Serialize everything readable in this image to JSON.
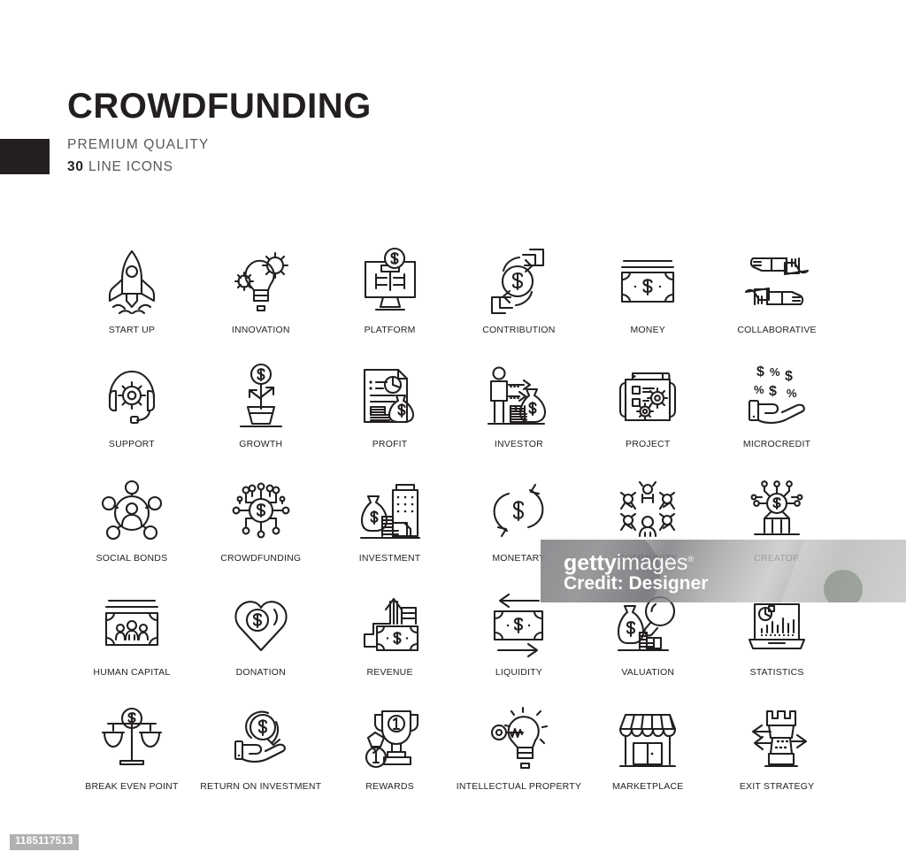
{
  "header": {
    "title": "CROWDFUNDING",
    "subtitle": "PREMIUM QUALITY",
    "count": "30",
    "count_label": " LINE ICONS"
  },
  "watermark": {
    "brand_bold": "getty",
    "brand_light": "images",
    "registered": "®",
    "credit": "Credit: Designer"
  },
  "asset_id": "1185117513",
  "colors": {
    "stroke": "#231f20",
    "title": "#231f20",
    "subtitle": "#58595b",
    "background": "#ffffff",
    "watermark_text": "#ffffff",
    "asset_id_bg": "#aaaaaa"
  },
  "grid": {
    "columns": 6,
    "rows": 5,
    "icons": [
      {
        "label": "START UP",
        "icon": "rocket-icon"
      },
      {
        "label": "INNOVATION",
        "icon": "lightbulb-gears-icon"
      },
      {
        "label": "PLATFORM",
        "icon": "monitor-coin-icon"
      },
      {
        "label": "CONTRIBUTION",
        "icon": "hands-dollar-cycle-icon"
      },
      {
        "label": "MONEY",
        "icon": "banknote-icon"
      },
      {
        "label": "COLLABORATIVE",
        "icon": "four-hands-icon"
      },
      {
        "label": "SUPPORT",
        "icon": "headset-gear-icon"
      },
      {
        "label": "GROWTH",
        "icon": "plant-coin-icon"
      },
      {
        "label": "PROFIT",
        "icon": "document-chart-moneybag-icon"
      },
      {
        "label": "INVESTOR",
        "icon": "person-arrows-moneybag-icon"
      },
      {
        "label": "PROJECT",
        "icon": "blueprint-gears-icon"
      },
      {
        "label": "MICROCREDIT",
        "icon": "hand-dollar-percent-icon"
      },
      {
        "label": "SOCIAL BONDS",
        "icon": "network-person-icon"
      },
      {
        "label": "CROWDFUNDING",
        "icon": "circuit-coin-icon"
      },
      {
        "label": "INVESTMENT",
        "icon": "moneybag-coins-building-icon"
      },
      {
        "label": "MONETARY",
        "icon": "dollar-refresh-icon"
      },
      {
        "label": "COMMUNITY",
        "icon": "people-circle-icon"
      },
      {
        "label": "CREATOR",
        "icon": "person-circuit-coin-icon"
      },
      {
        "label": "HUMAN CAPITAL",
        "icon": "banknote-people-icon"
      },
      {
        "label": "DONATION",
        "icon": "heart-coin-icon"
      },
      {
        "label": "REVENUE",
        "icon": "arrow-up-banknote-icon"
      },
      {
        "label": "LIQUIDITY",
        "icon": "banknote-arrows-icon"
      },
      {
        "label": "VALUATION",
        "icon": "moneybag-magnifier-icon"
      },
      {
        "label": "STATISTICS",
        "icon": "laptop-charts-icon"
      },
      {
        "label": "BREAK EVEN POINT",
        "icon": "scales-dollar-icon"
      },
      {
        "label": "RETURN ON INVESTMENT",
        "icon": "hand-coin-arrow-icon"
      },
      {
        "label": "REWARDS",
        "icon": "trophy-medal-icon"
      },
      {
        "label": "INTELLECTUAL PROPERTY",
        "icon": "key-lightbulb-icon"
      },
      {
        "label": "MARKETPLACE",
        "icon": "storefront-icon"
      },
      {
        "label": "EXIT STRATEGY",
        "icon": "rook-arrows-icon"
      }
    ]
  }
}
